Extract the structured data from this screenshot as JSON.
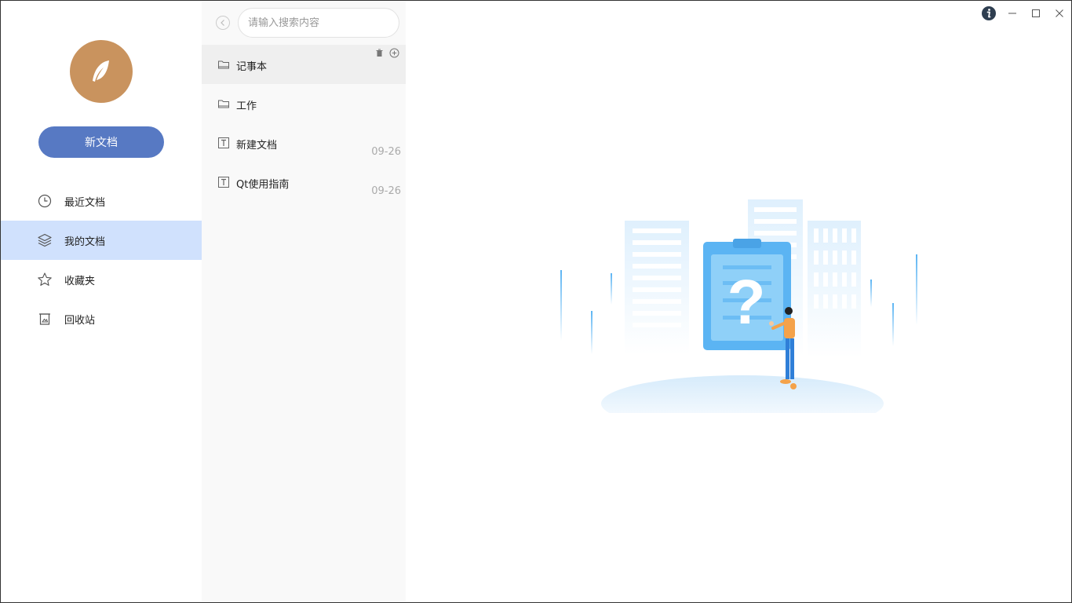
{
  "sidebar": {
    "new_doc_label": "新文档",
    "items": [
      {
        "label": "最近文档",
        "icon": "clock-icon"
      },
      {
        "label": "我的文档",
        "icon": "layers-icon"
      },
      {
        "label": "收藏夹",
        "icon": "star-icon"
      },
      {
        "label": "回收站",
        "icon": "trash-bin-icon"
      }
    ],
    "active_index": 1
  },
  "list": {
    "search_placeholder": "请输入搜索内容",
    "items": [
      {
        "name": "记事本",
        "type": "folder",
        "date": ""
      },
      {
        "name": "工作",
        "type": "folder",
        "date": ""
      },
      {
        "name": "新建文档",
        "type": "document",
        "date": "09-26"
      },
      {
        "name": "Qt使用指南",
        "type": "document",
        "date": "09-26"
      }
    ],
    "selected_index": 0
  },
  "colors": {
    "accent": "#5779c3",
    "avatar": "#c9935e",
    "active_nav": "#d0e1fd",
    "illustration_blue": "#5bb4f3"
  }
}
